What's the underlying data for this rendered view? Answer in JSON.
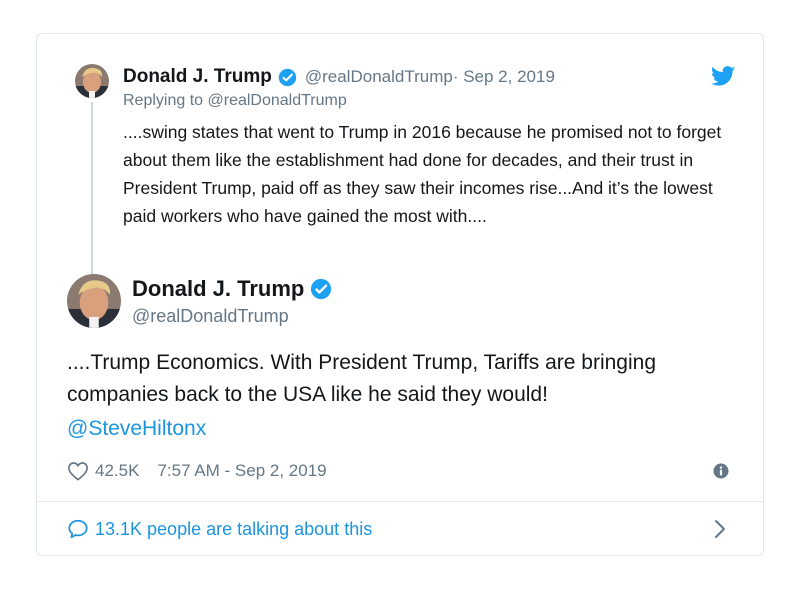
{
  "parent_tweet": {
    "name": "Donald J. Trump",
    "handle": "@realDonaldTrump",
    "date": " · Sep 2, 2019",
    "replying_prefix": "Replying to ",
    "replying_to": "@realDonaldTrump",
    "text": "....swing states that went to Trump in 2016 because he promised not to forget about them like the establishment had done for decades, and their trust in President Trump, paid off as they saw their incomes rise...And it’s the lowest paid workers who have gained the most with...."
  },
  "main_tweet": {
    "name": "Donald J. Trump",
    "handle": "@realDonaldTrump",
    "text": "....Trump Economics. With President Trump, Tariffs are bringing companies back to the USA like he said they would!",
    "mention": "@SteveHiltonx",
    "likes": "42.5K",
    "timestamp": "7:57 AM - Sep 2, 2019",
    "talking": "13.1K people are talking about this"
  },
  "icons": {
    "brand": "twitter-bird",
    "verified": "verified-badge",
    "like": "heart-outline",
    "info": "info-circle",
    "talk": "speech-bubble",
    "more": "chevron-right"
  },
  "colors": {
    "accent": "#1b95e0",
    "verified": "#1da1f2",
    "muted": "#657786",
    "text": "#14171a",
    "border": "#e1e8ed"
  }
}
